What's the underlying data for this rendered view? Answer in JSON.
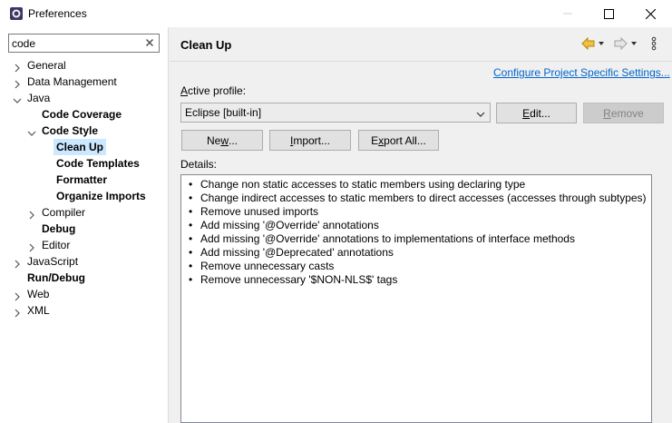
{
  "window": {
    "title": "Preferences"
  },
  "filter": {
    "value": "code"
  },
  "tree": {
    "general": "General",
    "data_management": "Data Management",
    "java": "Java",
    "code_coverage": "Code Coverage",
    "code_style": "Code Style",
    "clean_up": "Clean Up",
    "code_templates": "Code Templates",
    "formatter": "Formatter",
    "organize_imports": "Organize Imports",
    "compiler": "Compiler",
    "debug": "Debug",
    "editor": "Editor",
    "javascript": "JavaScript",
    "run_debug": "Run/Debug",
    "web": "Web",
    "xml": "XML"
  },
  "page": {
    "title": "Clean Up",
    "configure_link": "Configure Project Specific Settings...",
    "active_profile_prefix": "A",
    "active_profile_rest": "ctive profile:",
    "profile_value": "Eclipse [built-in]",
    "details_label": "Details:"
  },
  "buttons": {
    "edit_u": "E",
    "edit_rest": "dit...",
    "remove_u": "R",
    "remove_rest": "emove",
    "new_pre": "Ne",
    "new_u": "w",
    "new_rest": "...",
    "import_u": "I",
    "import_rest": "mport...",
    "export_pre": "E",
    "export_u": "x",
    "export_rest": "port All..."
  },
  "details": [
    "Change non static accesses to static members using declaring type",
    "Change indirect accesses to static members to direct accesses (accesses through subtypes)",
    "Remove unused imports",
    "Add missing '@Override' annotations",
    "Add missing '@Override' annotations to implementations of interface methods",
    "Add missing '@Deprecated' annotations",
    "Remove unnecessary casts",
    "Remove unnecessary '$NON-NLS$' tags"
  ],
  "colors": {
    "link": "#0066cc",
    "selection": "#cce8ff",
    "nav_back": "#e8a317"
  }
}
